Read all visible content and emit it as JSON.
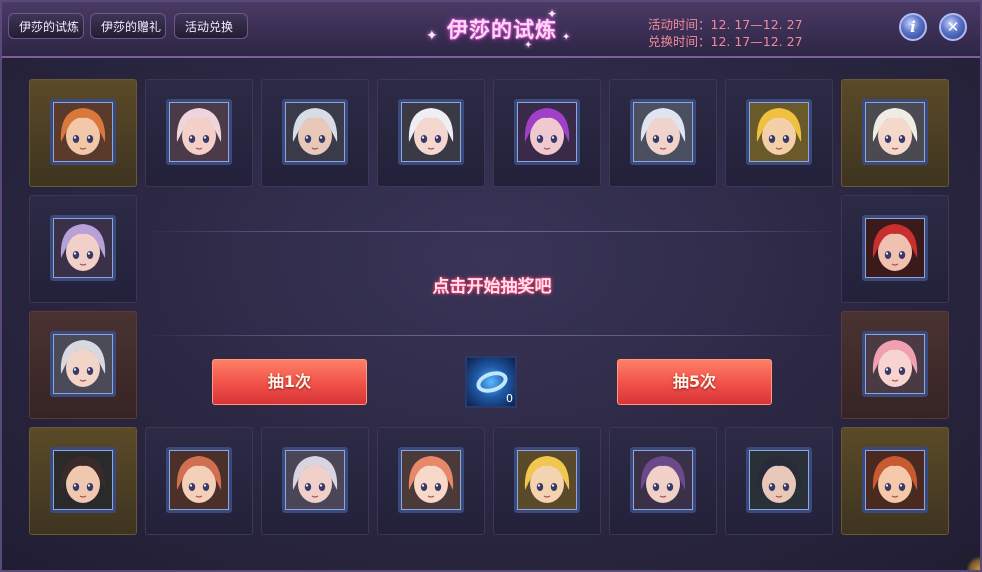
{
  "header": {
    "tabs": [
      {
        "label": "伊莎的试炼"
      },
      {
        "label": "伊莎的赠礼"
      },
      {
        "label": "活动兑换"
      }
    ],
    "title": "伊莎的试炼",
    "activity_time": "活动时间：12. 17—12. 27",
    "exchange_time": "兑换时间：12. 17—12. 27",
    "info_icon_glyph": "i",
    "close_icon_glyph": "✕"
  },
  "main": {
    "prompt": "点击开始抽奖吧",
    "draw_once_label": "抽1次",
    "draw_five_label": "抽5次",
    "token_count": "0"
  },
  "colors": {
    "accent_red": "#f05048",
    "time_text": "#f08a9a",
    "title_glow": "#c046c8"
  },
  "portraits": [
    {
      "hair": "#d9783a",
      "skin": "#f2c8a8",
      "bg": "#5a3a2a"
    },
    {
      "hair": "#f0d4dc",
      "skin": "#f4d0c8",
      "bg": "#4a3a4a"
    },
    {
      "hair": "#d8dce6",
      "skin": "#e8c8b8",
      "bg": "#3a3a4a"
    },
    {
      "hair": "#f0eef2",
      "skin": "#f4d8d0",
      "bg": "#3a3a46"
    },
    {
      "hair": "#a040c8",
      "skin": "#f0c8d0",
      "bg": "#3a2a4a"
    },
    {
      "hair": "#e0e4f0",
      "skin": "#f0d4cc",
      "bg": "#4a5060"
    },
    {
      "hair": "#f0c040",
      "skin": "#f4d0a8",
      "bg": "#6a5a2a"
    },
    {
      "hair": "#f0ece4",
      "skin": "#f4d8cc",
      "bg": "#4a4a50"
    },
    {
      "hair": "#b8a0d8",
      "skin": "#f0d0c8",
      "bg": "#3a3048"
    },
    {
      "hair": "#c83030",
      "skin": "#f0c0b0",
      "bg": "#3a1a1a"
    },
    {
      "hair": "#d8d8e0",
      "skin": "#f2d4c8",
      "bg": "#4a4a58"
    },
    {
      "hair": "#f0a0b0",
      "skin": "#f8d4d0",
      "bg": "#4a3a44"
    },
    {
      "hair": "#3a2a2a",
      "skin": "#f0c8b0",
      "bg": "#2a2a2a"
    },
    {
      "hair": "#d07050",
      "skin": "#f4d0b8",
      "bg": "#4a3028"
    },
    {
      "hair": "#d8d4e0",
      "skin": "#f0d0c8",
      "bg": "#4a4658"
    },
    {
      "hair": "#e88868",
      "skin": "#f8d8c8",
      "bg": "#4a3a3a"
    },
    {
      "hair": "#f0c850",
      "skin": "#f4d4b0",
      "bg": "#5a4a2a"
    },
    {
      "hair": "#6a4a8a",
      "skin": "#f0d0c8",
      "bg": "#3a3048"
    },
    {
      "hair": "#2a2a3a",
      "skin": "#e8c8b8",
      "bg": "#2a3038"
    },
    {
      "hair": "#c85a30",
      "skin": "#f4c8a8",
      "bg": "#4a2a20"
    }
  ]
}
